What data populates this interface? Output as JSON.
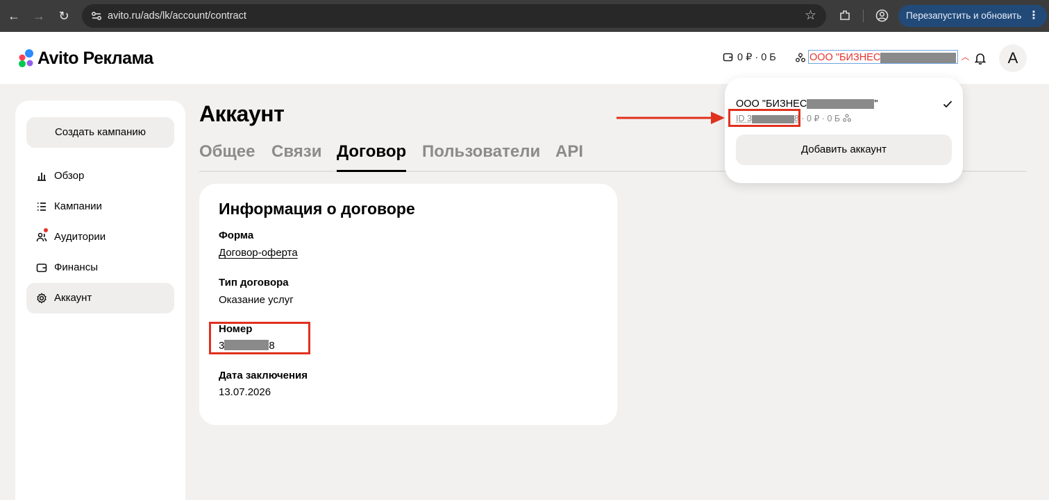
{
  "browser": {
    "url": "avito.ru/ads/lk/account/contract",
    "restart_label": "Перезапустить и обновить"
  },
  "header": {
    "logo_text": "Avito Реклама",
    "balance": "0 ₽ · 0 Б",
    "org_name": "ООО \"БИЗНЕС",
    "avatar_letter": "А"
  },
  "sidebar": {
    "create_button": "Создать кампанию",
    "items": [
      {
        "label": "Обзор",
        "icon": "chart-icon"
      },
      {
        "label": "Кампании",
        "icon": "list-icon"
      },
      {
        "label": "Аудитории",
        "icon": "people-icon"
      },
      {
        "label": "Финансы",
        "icon": "wallet-icon"
      },
      {
        "label": "Аккаунт",
        "icon": "gear-icon"
      }
    ]
  },
  "main": {
    "title": "Аккаунт",
    "tabs": [
      "Общее",
      "Связи",
      "Договор",
      "Пользователи",
      "API"
    ],
    "active_tab": "Договор"
  },
  "contract": {
    "heading": "Информация о договоре",
    "form_label": "Форма",
    "form_value": "Договор-оферта",
    "type_label": "Тип договора",
    "type_value": "Оказание услуг",
    "number_label": "Номер",
    "number_prefix": "3",
    "number_suffix": "8",
    "date_label": "Дата заключения",
    "date_value": "13.07.2026"
  },
  "dropdown": {
    "org_name": "ООО \"БИЗНЕС",
    "org_name_end": "\"",
    "id_prefix": "ID 3",
    "id_suffix": "8",
    "meta": "· 0 ₽ · 0 Б",
    "add_button": "Добавить аккаунт"
  },
  "colors": {
    "accent_red": "#e5332a",
    "annotation_red": "#e0301e",
    "restart_bg": "#214a79"
  }
}
